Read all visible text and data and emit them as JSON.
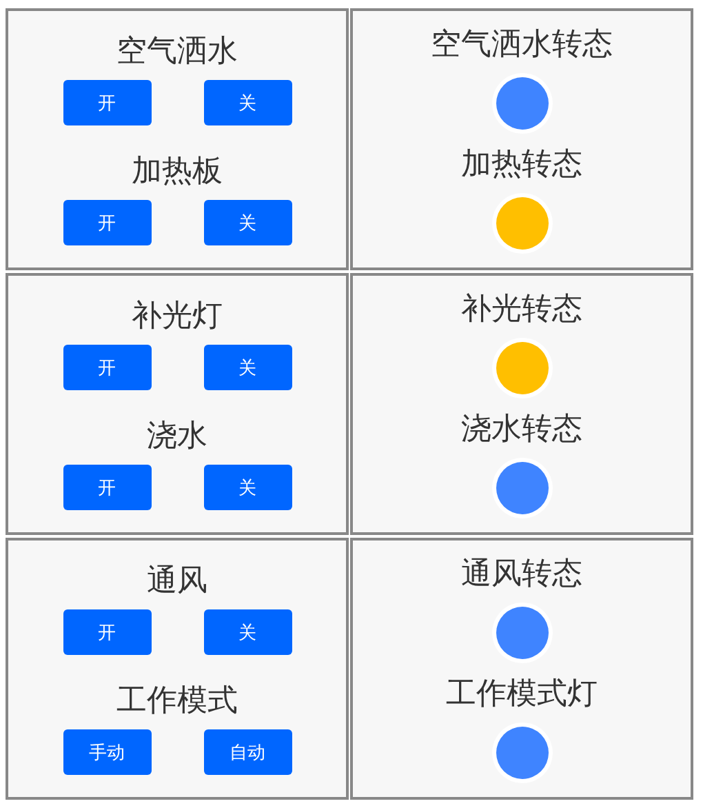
{
  "rows": [
    {
      "controls": [
        {
          "label": "空气洒水",
          "buttons": [
            "开",
            "关"
          ]
        },
        {
          "label": "加热板",
          "buttons": [
            "开",
            "关"
          ]
        }
      ],
      "statuses": [
        {
          "label": "空气洒水转态",
          "color": "#3f84ff"
        },
        {
          "label": "加热转态",
          "color": "#ffbf00"
        }
      ]
    },
    {
      "controls": [
        {
          "label": "补光灯",
          "buttons": [
            "开",
            "关"
          ]
        },
        {
          "label": "浇水",
          "buttons": [
            "开",
            "关"
          ]
        }
      ],
      "statuses": [
        {
          "label": "补光转态",
          "color": "#ffbf00"
        },
        {
          "label": "浇水转态",
          "color": "#3f84ff"
        }
      ]
    },
    {
      "controls": [
        {
          "label": "通风",
          "buttons": [
            "开",
            "关"
          ]
        },
        {
          "label": "工作模式",
          "buttons": [
            "手动",
            "自动"
          ]
        }
      ],
      "statuses": [
        {
          "label": "通风转态",
          "color": "#3f84ff"
        },
        {
          "label": "工作模式灯",
          "color": "#3f84ff"
        }
      ]
    }
  ]
}
